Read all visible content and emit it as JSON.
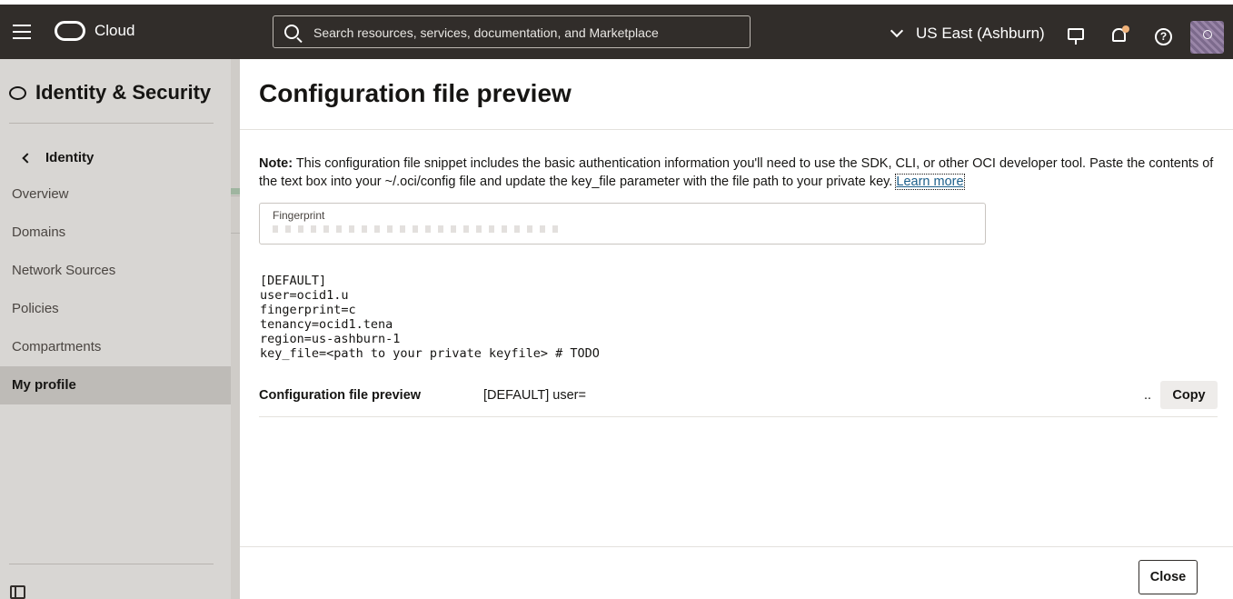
{
  "header": {
    "brand": "Cloud",
    "search_placeholder": "Search resources, services, documentation, and Marketplace",
    "region": "US East (Ashburn)",
    "icons": [
      "menu-icon",
      "oracle-logo",
      "search-icon",
      "chevron-down-icon",
      "developer-tools-icon",
      "bell-icon",
      "help-icon",
      "avatar"
    ]
  },
  "sidebar": {
    "title": "Identity & Security",
    "back_label": "Identity",
    "items": [
      {
        "label": "Overview"
      },
      {
        "label": "Domains"
      },
      {
        "label": "Network Sources"
      },
      {
        "label": "Policies"
      },
      {
        "label": "Compartments"
      },
      {
        "label": "My profile",
        "active": true
      }
    ]
  },
  "panel": {
    "title": "Configuration file preview",
    "note_bold": "Note:",
    "note_text": " This configuration file snippet includes the basic authentication information you'll need to use the SDK, CLI, or other OCI developer tool. Paste the contents of the text box into your ~/.oci/config file and update the key_file parameter with the file path to your private key.",
    "learn_more": "Learn more",
    "fingerprint_label": "Fingerprint",
    "config_lines": {
      "l1": "[DEFAULT]",
      "l2": "user=ocid1.u",
      "l3": "fingerprint=c",
      "l4": "tenancy=ocid1.tena",
      "l5": "region=us-ashburn-1",
      "l6": "key_file=<path to your private keyfile> # TODO"
    },
    "preview_row": {
      "label": "Configuration file preview",
      "value": "[DEFAULT] user=",
      "ellipsis": "..",
      "copy_label": "Copy"
    },
    "close_label": "Close"
  }
}
